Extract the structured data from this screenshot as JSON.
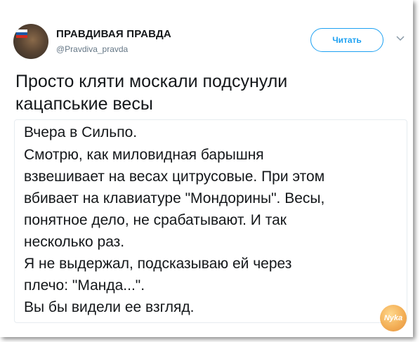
{
  "account": {
    "name": "ПРАВДИВАЯ ПРАВДА",
    "handle": "@Pravdiva_pravda"
  },
  "follow_button": {
    "label": "Читать"
  },
  "tweet": {
    "lines": [
      "Просто кляти москали подсунули",
      "кацапськие весы"
    ]
  },
  "quoted_text": {
    "lines": [
      "Вчера в Сильпо.",
      "Смотрю, как миловидная барышня",
      "взвешивает на весах цитрусовые. При этом",
      "вбивает на клавиатуре \"Мондорины\". Весы,",
      "понятное дело, не срабатывают. И так",
      "несколько раз.",
      "Я не выдержал, подсказываю ей через",
      "плечо: \"Манда...\".",
      "Вы бы видели ее взгляд."
    ]
  },
  "watermark": {
    "text": "Nyka"
  },
  "colors": {
    "accent": "#1da1f2",
    "text": "#14171a",
    "muted": "#657786"
  }
}
